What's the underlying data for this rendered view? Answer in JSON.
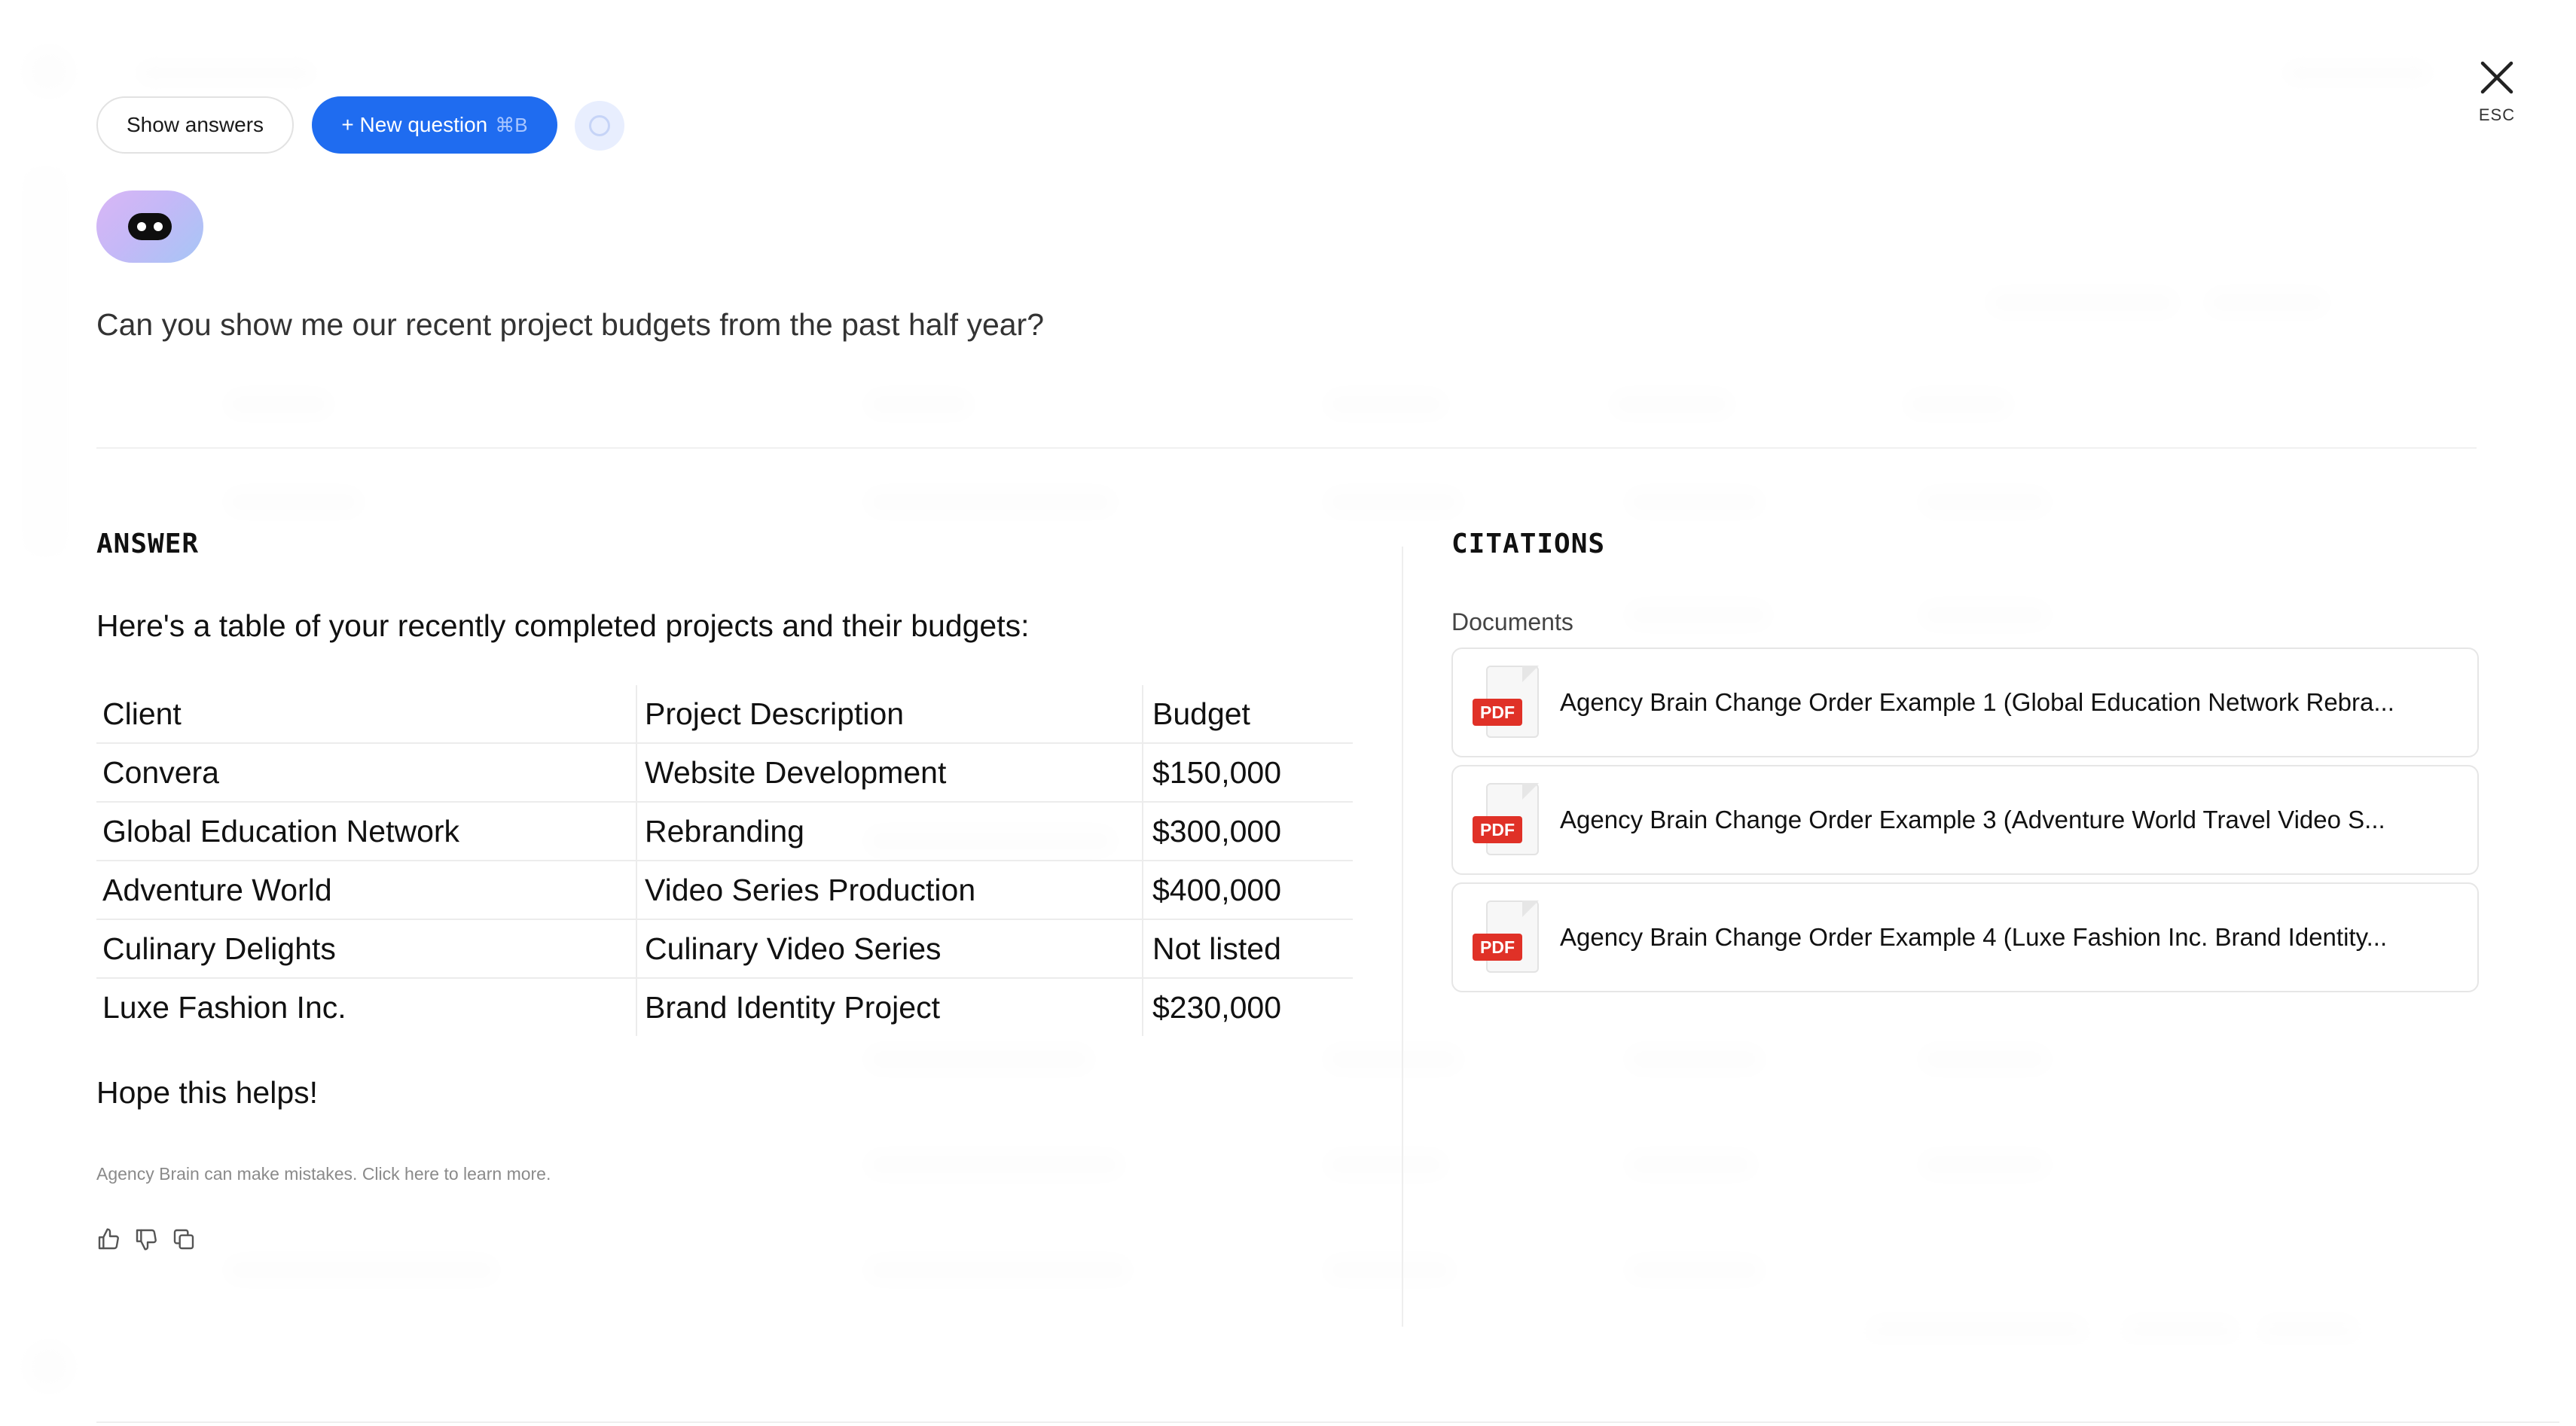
{
  "header": {
    "show_answers_label": "Show answers",
    "new_question_label": "+ New question",
    "new_question_shortcut": "⌘B",
    "close_label": "ESC"
  },
  "question": "Can you show me our recent project budgets from the past half year?",
  "answer": {
    "section_title": "ANSWER",
    "intro": "Here's a table of your recently completed projects and their budgets:",
    "table": {
      "headers": [
        "Client",
        "Project Description",
        "Budget"
      ],
      "rows": [
        [
          "Convera",
          "Website Development",
          "$150,000"
        ],
        [
          "Global Education Network",
          "Rebranding",
          "$300,000"
        ],
        [
          "Adventure World",
          "Video Series Production",
          "$400,000"
        ],
        [
          "Culinary Delights",
          "Culinary Video Series",
          "Not listed"
        ],
        [
          "Luxe Fashion Inc.",
          "Brand Identity Project",
          "$230,000"
        ]
      ]
    },
    "closing": "Hope this helps!",
    "disclaimer": "Agency Brain can make mistakes. Click here to learn more."
  },
  "citations": {
    "section_title": "CITATIONS",
    "documents_label": "Documents",
    "documents": [
      {
        "type": "PDF",
        "title": "Agency Brain Change Order Example 1 (Global Education Network Rebra..."
      },
      {
        "type": "PDF",
        "title": "Agency Brain Change Order Example 3 (Adventure World Travel Video S..."
      },
      {
        "type": "PDF",
        "title": "Agency Brain Change Order Example 4 (Luxe Fashion Inc. Brand Identity..."
      }
    ]
  },
  "colors": {
    "accent": "#1f6cf0",
    "pdf_badge": "#e03127"
  },
  "icons": [
    "close-icon",
    "assistant-avatar",
    "thumbs-up-icon",
    "thumbs-down-icon",
    "copy-icon",
    "pdf-file-icon"
  ]
}
